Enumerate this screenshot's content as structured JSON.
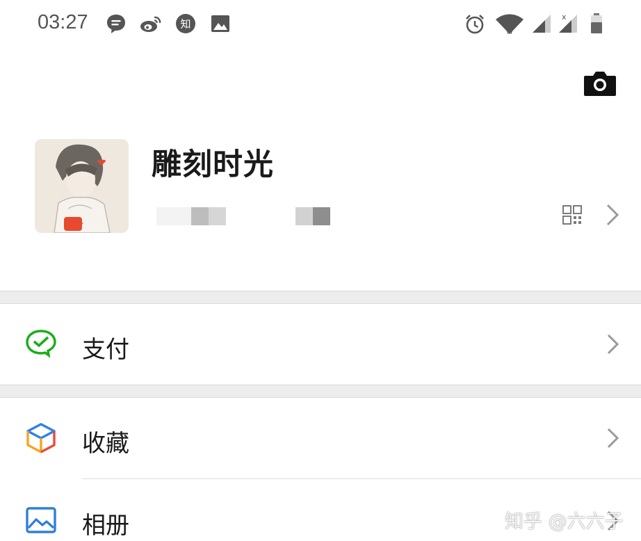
{
  "status_bar": {
    "time": "03:27",
    "left_icons": [
      "message-icon",
      "weibo-icon",
      "zhihu-icon",
      "image-icon"
    ],
    "zhihu_glyph": "知",
    "right_icons": [
      "alarm-icon",
      "wifi-icon",
      "signal-icon",
      "signal-no-service-icon",
      "battery-icon"
    ],
    "no_service_mark": "x"
  },
  "header": {
    "camera_icon": "camera-icon"
  },
  "profile": {
    "name": "雕刻时光",
    "wechat_id_blurred": true,
    "qr_icon": "qr-code-icon"
  },
  "menu": {
    "items": [
      {
        "label": "支付",
        "icon": "pay-icon",
        "icon_color": "#1aad19"
      },
      {
        "label": "收藏",
        "icon": "favorites-cube-icon",
        "icon_colors": [
          "#2f80ed",
          "#f5a623",
          "#e94b3c"
        ]
      },
      {
        "label": "相册",
        "icon": "album-icon",
        "icon_color": "#2f7fd8"
      }
    ]
  },
  "watermark": "知乎 @六六子",
  "colors": {
    "divider_band": "#ededed",
    "text_primary": "#1a1a1a",
    "chevron": "#9a9a9a"
  }
}
